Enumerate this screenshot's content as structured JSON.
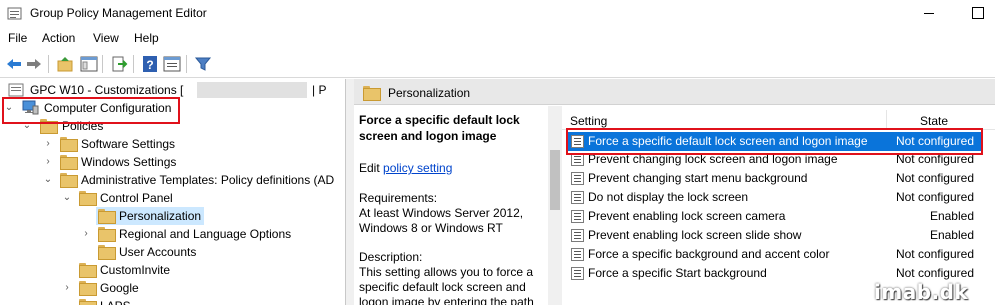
{
  "window": {
    "title": "Group Policy Management Editor",
    "minimize_icon": "minimize-icon",
    "maximize_icon": "maximize-icon"
  },
  "menu": [
    "File",
    "Action",
    "View",
    "Help"
  ],
  "toolbar": {
    "icons": [
      "back-arrow-icon",
      "forward-arrow-icon",
      "up-folder-icon",
      "show-hide-tree-icon",
      "export-list-icon",
      "help-icon",
      "properties-icon",
      "filter-icon"
    ]
  },
  "tree": {
    "root": "GPC W10 - Customizations [",
    "root_suffix": "| P",
    "computer_configuration": "Computer Configuration",
    "policies": "Policies",
    "software_settings": "Software Settings",
    "windows_settings": "Windows Settings",
    "admin_templates": "Administrative Templates: Policy definitions (AD",
    "control_panel": "Control Panel",
    "personalization": "Personalization",
    "regional": "Regional and Language Options",
    "user_accounts": "User Accounts",
    "custominvite": "CustomInvite",
    "google": "Google",
    "laps": "LAPS"
  },
  "right_header": "Personalization",
  "description": {
    "title": "Force a specific default lock screen and logon image",
    "edit_prefix": "Edit ",
    "edit_link": "policy setting",
    "requirements_label": "Requirements:",
    "requirements_text": "At least Windows Server 2012, Windows 8 or Windows RT",
    "description_label": "Description:",
    "description_text": "This setting allows you to force a specific default lock screen and logon image by entering the path"
  },
  "list": {
    "header_setting": "Setting",
    "header_state": "State",
    "rows": [
      {
        "name": "Force a specific default lock screen and logon image",
        "state": "Not configured"
      },
      {
        "name": "Prevent changing lock screen and logon image",
        "state": "Not configured"
      },
      {
        "name": "Prevent changing start menu background",
        "state": "Not configured"
      },
      {
        "name": "Do not display the lock screen",
        "state": "Not configured"
      },
      {
        "name": "Prevent enabling lock screen camera",
        "state": "Enabled"
      },
      {
        "name": "Prevent enabling lock screen slide show",
        "state": "Enabled"
      },
      {
        "name": "Force a specific background and accent color",
        "state": "Not configured"
      },
      {
        "name": "Force a specific Start background",
        "state": "Not configured"
      }
    ]
  },
  "watermark": "imab.dk",
  "colors": {
    "selection": "#0a74da",
    "highlight_box": "#e0111b",
    "tree_selected": "#cce8ff"
  }
}
